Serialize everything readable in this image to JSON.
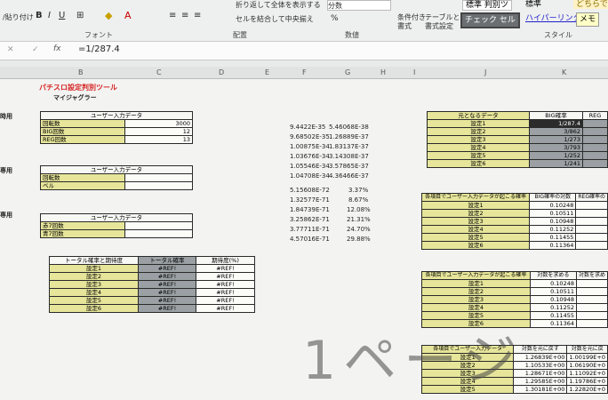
{
  "ribbon": {
    "wrap_text": "折り返して全体を表示する",
    "merge_center": "セルを結合して中央揃え",
    "number_format": "分数",
    "cond_format": "条件付き",
    "cond_format2": "書式",
    "table_format": "テーブルとして",
    "table_format2": "書式設定",
    "style_standard2": "標準 判別ツ",
    "style_standard": "標準",
    "style_good": "どちらでも",
    "style_check": "チェック セル",
    "style_hyperlink": "ハイパーリンク",
    "style_memo": "メモ",
    "clipboard": "/貼り付け",
    "font_group": "フォント",
    "align_group": "配置",
    "number_group": "数値",
    "style_group": "スタイル",
    "percent": "%"
  },
  "formula_bar": {
    "fx": "fx",
    "formula": "=1/287.4"
  },
  "columns": [
    "B",
    "C",
    "D",
    "E",
    "F",
    "G",
    "H",
    "I",
    "J",
    "K"
  ],
  "left": {
    "title": "パチスロ設定判別ツール",
    "subtitle": "マイジャグラー",
    "row_label_1": "時用",
    "row_label_2": "専用",
    "row_label_3": "専用",
    "table1": {
      "header": "ユーザー入力データ",
      "rows": [
        {
          "label": "回転数",
          "value": "3000"
        },
        {
          "label": "BIG回数",
          "value": "12"
        },
        {
          "label": "REG回数",
          "value": "13"
        }
      ]
    },
    "table2": {
      "header": "ユーザー入力データ",
      "rows": [
        {
          "label": "回転数"
        },
        {
          "label": "ベル"
        }
      ]
    },
    "table3": {
      "header": "ユーザー入力データ",
      "rows": [
        {
          "label": "赤7回数"
        },
        {
          "label": "青7回数"
        }
      ]
    },
    "table4": {
      "headers": [
        "トータル確率と期待度",
        "トータル確率",
        "期待度(%)"
      ],
      "rows": [
        {
          "label": "設定1",
          "v1": "#REF!",
          "v2": "#REF!"
        },
        {
          "label": "設定2",
          "v1": "#REF!",
          "v2": "#REF!"
        },
        {
          "label": "設定3",
          "v1": "#REF!",
          "v2": "#REF!"
        },
        {
          "label": "設定4",
          "v1": "#REF!",
          "v2": "#REF!"
        },
        {
          "label": "設定5",
          "v1": "#REF!",
          "v2": "#REF!"
        },
        {
          "label": "設定6",
          "v1": "#REF!",
          "v2": "#REF!"
        }
      ]
    }
  },
  "middle": {
    "block1": [
      [
        "9.4422E-35",
        "5.46068E-38"
      ],
      [
        "9.68502E-35",
        "1.26889E-37"
      ],
      [
        "1.00875E-34",
        "1.83137E-37"
      ],
      [
        "1.03676E-34",
        "3.14308E-37"
      ],
      [
        "1.05546E-34",
        "3.57865E-37"
      ],
      [
        "1.04708E-34",
        "4.36466E-37"
      ]
    ],
    "block2": [
      [
        "5.15608E-72",
        "3.37%"
      ],
      [
        "1.32577E-71",
        "8.67%"
      ],
      [
        "1.84739E-71",
        "12.08%"
      ],
      [
        "3.25862E-71",
        "21.31%"
      ],
      [
        "3.77711E-71",
        "24.70%"
      ],
      [
        "4.57016E-71",
        "29.88%"
      ]
    ]
  },
  "right": {
    "table1": {
      "headers": [
        "元となるデータ",
        "BIG確率",
        "REG"
      ],
      "rows": [
        {
          "label": "設定1",
          "value": "1/287.4"
        },
        {
          "label": "設定2",
          "value": "3/862"
        },
        {
          "label": "設定3",
          "value": "1/273"
        },
        {
          "label": "設定4",
          "value": "3/793"
        },
        {
          "label": "設定5",
          "value": "1/252"
        },
        {
          "label": "設定6",
          "value": "1/241"
        }
      ]
    },
    "table2": {
      "headers": [
        "各項目でユーザー入力データが起こる確率",
        "BIG確率の対数",
        "REG確率の"
      ],
      "rows": [
        {
          "label": "設定1",
          "value": "0.10248"
        },
        {
          "label": "設定2",
          "value": "0.10511"
        },
        {
          "label": "設定3",
          "value": "0.10948"
        },
        {
          "label": "設定4",
          "value": "0.11252"
        },
        {
          "label": "設定5",
          "value": "0.11455"
        },
        {
          "label": "設定6",
          "value": "0.11364"
        }
      ]
    },
    "table3": {
      "headers": [
        "各項目でユーザー入力データが起こる確率",
        "対数を求める",
        "対数を求め"
      ],
      "rows": [
        {
          "label": "設定1",
          "value": "0.10248"
        },
        {
          "label": "設定2",
          "value": "0.10511"
        },
        {
          "label": "設定3",
          "value": "0.10948"
        },
        {
          "label": "設定4",
          "value": "0.11252"
        },
        {
          "label": "設定5",
          "value": "0.11455"
        },
        {
          "label": "設定6",
          "value": "0.11364"
        }
      ]
    },
    "table4": {
      "headers": [
        "各項目でユーザー入力データ",
        "対数を元に戻す",
        "対数を元に戻"
      ],
      "rows": [
        {
          "label": "設定1",
          "value": "1.26839E+00",
          "value2": "1.00199E+0"
        },
        {
          "label": "設定2",
          "value": "1.10533E+00",
          "value2": "1.06190E+0"
        },
        {
          "label": "設定3",
          "value": "1.28671E+00",
          "value2": "1.11092E+0"
        },
        {
          "label": "設定4",
          "value": "1.29585E+00",
          "value2": "1.19786E+0"
        },
        {
          "label": "設定5",
          "value": "1.30181E+00",
          "value2": "1.22820E+0"
        }
      ]
    }
  },
  "watermark": "1ページ"
}
